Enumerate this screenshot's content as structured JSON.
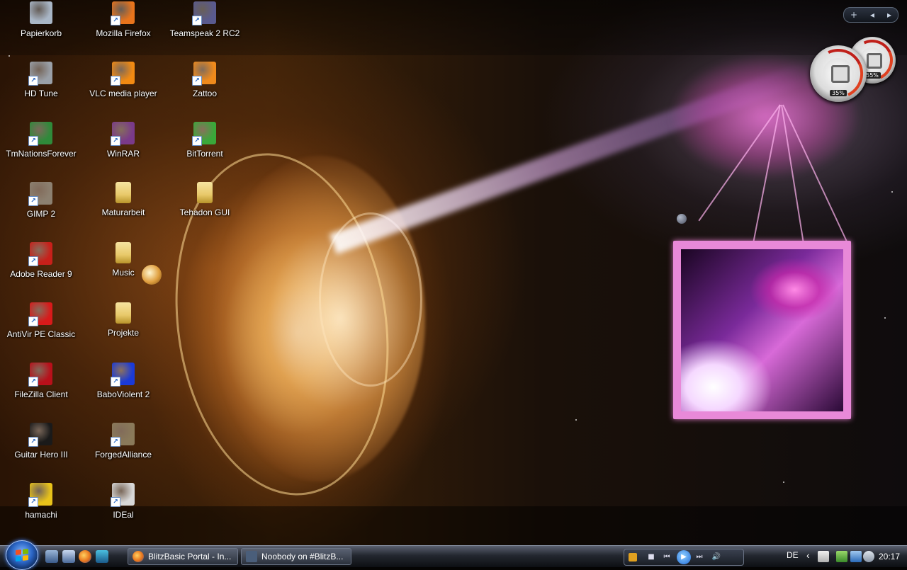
{
  "desktop": {
    "icons": [
      {
        "label": "Papierkorb",
        "icon": "recycle-bin-icon",
        "color": "#a9b6c6"
      },
      {
        "label": "Mozilla Firefox",
        "icon": "firefox-icon",
        "color": "#e8741c"
      },
      {
        "label": "Teamspeak 2 RC2",
        "icon": "teamspeak-icon",
        "color": "#5a5a8e"
      },
      {
        "label": "HD Tune",
        "icon": "hd-tune-icon",
        "color": "#9aa0a8"
      },
      {
        "label": "VLC media player",
        "icon": "vlc-icon",
        "color": "#f28a12"
      },
      {
        "label": "Zattoo",
        "icon": "zattoo-icon",
        "color": "#f08a1c"
      },
      {
        "label": "TmNationsForever",
        "icon": "tmnations-icon",
        "color": "#2f8a3a"
      },
      {
        "label": "WinRAR",
        "icon": "winrar-icon",
        "color": "#7a3a8a"
      },
      {
        "label": "BitTorrent",
        "icon": "bittorrent-icon",
        "color": "#3aa83a"
      },
      {
        "label": "GIMP 2",
        "icon": "gimp-icon",
        "color": "#8c8070"
      },
      {
        "label": "Maturarbeit",
        "icon": "folder-icon",
        "color": "#e8c96a"
      },
      {
        "label": "Tehadon GUI",
        "icon": "folder-icon",
        "color": "#e8c96a"
      },
      {
        "label": "Adobe Reader 9",
        "icon": "adobe-reader-icon",
        "color": "#c8201a"
      },
      {
        "label": "Music",
        "icon": "folder-icon",
        "color": "#e8c96a"
      },
      {
        "label": "AntiVir PE Classic",
        "icon": "antivir-icon",
        "color": "#d81a1a"
      },
      {
        "label": "Projekte",
        "icon": "folder-icon",
        "color": "#e8c96a"
      },
      {
        "label": "FileZilla Client",
        "icon": "filezilla-icon",
        "color": "#b8101a"
      },
      {
        "label": "BaboViolent 2",
        "icon": "baboviolent-icon",
        "color": "#1a3ad8"
      },
      {
        "label": "Guitar Hero III",
        "icon": "guitar-hero-icon",
        "color": "#1a1a1a"
      },
      {
        "label": "ForgedAlliance",
        "icon": "forged-alliance-icon",
        "color": "#8a7a5a"
      },
      {
        "label": "hamachi",
        "icon": "hamachi-icon",
        "color": "#e8c21a"
      },
      {
        "label": "IDEal",
        "icon": "ideal-icon",
        "color": "#d8d8d8"
      }
    ]
  },
  "gadgets": {
    "sidebar_controls": {
      "add": "+",
      "prev": "◂",
      "next": "▸"
    },
    "cpu_meter": {
      "cpu_percent": "35%",
      "memory_percent": "55%"
    }
  },
  "taskbar": {
    "quick_launch": [
      "show-desktop-icon",
      "switch-windows-icon",
      "firefox-icon",
      "wallpaper-icon"
    ],
    "windows": [
      {
        "label": "BlitzBasic Portal - In...",
        "icon": "firefox-icon",
        "color": "#e8741c"
      },
      {
        "label": "Noobody on #BlitzB...",
        "icon": "chatzilla-icon",
        "color": "#4a5e7a"
      }
    ],
    "media": {
      "stop": "■",
      "prev": "⏮",
      "play": "▶",
      "next": "⏭",
      "volume": "🔊"
    },
    "tray": {
      "language": "DE",
      "chevron": "‹",
      "clock": "20:17"
    }
  }
}
